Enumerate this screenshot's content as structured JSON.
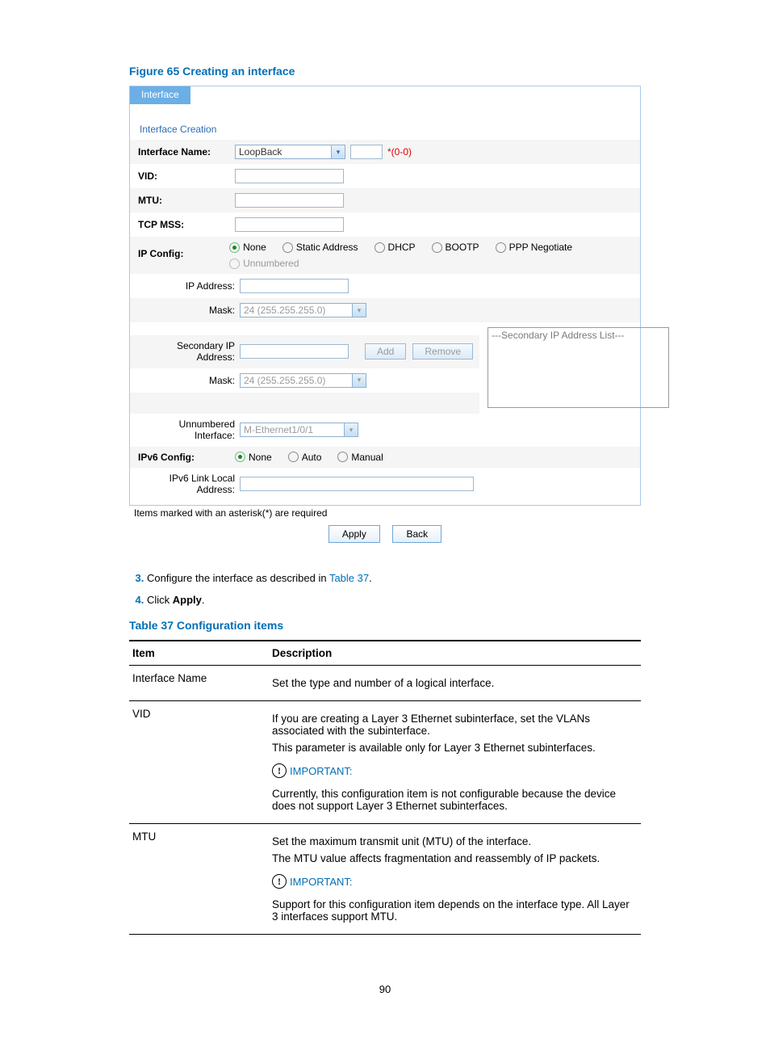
{
  "figure_caption": "Figure 65 Creating an interface",
  "tab_label": "Interface",
  "panel_title": "Interface Creation",
  "labels": {
    "interface_name": "Interface Name:",
    "vid": "VID:",
    "mtu": "MTU:",
    "tcp_mss": "TCP MSS:",
    "ip_config": "IP Config:",
    "ip_address": "IP Address:",
    "mask": "Mask:",
    "secondary_ip": "Secondary IP Address:",
    "mask2": "Mask:",
    "unnumbered_if": "Unnumbered Interface:",
    "ipv6_config": "IPv6 Config:",
    "ipv6_lla": "IPv6 Link Local Address:"
  },
  "values": {
    "interface_type": "LoopBack",
    "interface_hint": "*(0-0)",
    "mask_value": "24 (255.255.255.0)",
    "unnumbered_if_value": "M-Ethernet1/0/1",
    "secondary_list_title": "---Secondary IP Address List---"
  },
  "radios": {
    "ip": [
      "None",
      "Static Address",
      "DHCP",
      "BOOTP",
      "PPP Negotiate",
      "Unnumbered"
    ],
    "ipv6": [
      "None",
      "Auto",
      "Manual"
    ]
  },
  "buttons": {
    "add": "Add",
    "remove": "Remove",
    "apply": "Apply",
    "back": "Back"
  },
  "note": "Items marked with an asterisk(*) are required",
  "steps": {
    "s3_prefix": "Configure the interface as described in ",
    "s3_link": "Table 37",
    "s3_suffix": ".",
    "s4_prefix": "Click ",
    "s4_bold": "Apply",
    "s4_suffix": "."
  },
  "table_caption": "Table 37 Configuration items",
  "table": {
    "h1": "Item",
    "h2": "Description",
    "rows": [
      {
        "item": "Interface Name",
        "desc": [
          "Set the type and number of a logical interface."
        ]
      },
      {
        "item": "VID",
        "desc": [
          "If you are creating a Layer 3 Ethernet subinterface, set the VLANs associated with the subinterface.",
          "This parameter is available only for Layer 3 Ethernet subinterfaces.",
          "__IMPORTANT__",
          "Currently, this configuration item is not configurable because the device does not support Layer 3 Ethernet subinterfaces."
        ]
      },
      {
        "item": "MTU",
        "desc": [
          "Set the maximum transmit unit (MTU) of the interface.",
          "The MTU value affects fragmentation and reassembly of IP packets.",
          "__IMPORTANT__",
          "Support for this configuration item depends on the interface type. All Layer 3 interfaces support MTU."
        ]
      }
    ]
  },
  "important_label": "IMPORTANT:",
  "page_number": "90",
  "chart_data": null
}
